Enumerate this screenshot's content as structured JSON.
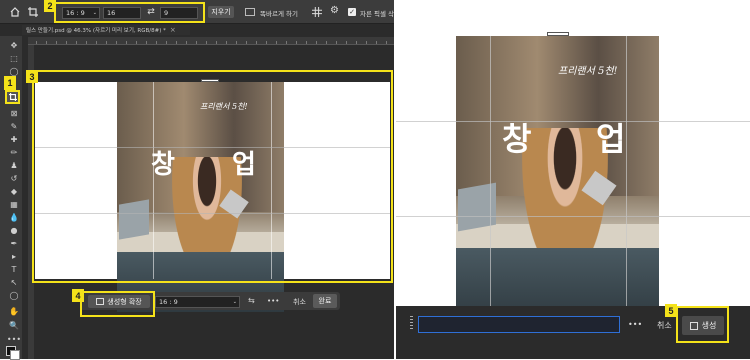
{
  "top_bar": {
    "home_icon": "home-icon",
    "ratio": "16 : 9",
    "width": "16",
    "swap_icon": "swap-icon",
    "height": "9",
    "clear_label": "지우기",
    "straighten_label": "똑바르게 하기",
    "delete_cropped_label": "자른 픽셀 삭"
  },
  "document_tab": {
    "title": "릴스 만들기.psd @ 46.3% (자르기 미리 보기, RGB/8#) *",
    "close": "×"
  },
  "contextual_bar": {
    "generate_label": "생성형 확장",
    "ratio": "16 : 9",
    "more": "•••",
    "cancel_label": "취소",
    "done_label": "완료"
  },
  "right_bar": {
    "more": "•••",
    "cancel_label": "취소",
    "generate_label": "생성"
  },
  "canvas_text": {
    "script": "프리랜서 5천!",
    "char1": "창",
    "char2": "업"
  },
  "annotations": [
    "1",
    "2",
    "3",
    "4",
    "5"
  ],
  "colors": {
    "highlight": "#f4e21a",
    "ui_dark": "#3a3a3a",
    "ui_darker": "#2b2b2b",
    "accent_blue": "#2f6fd6"
  }
}
